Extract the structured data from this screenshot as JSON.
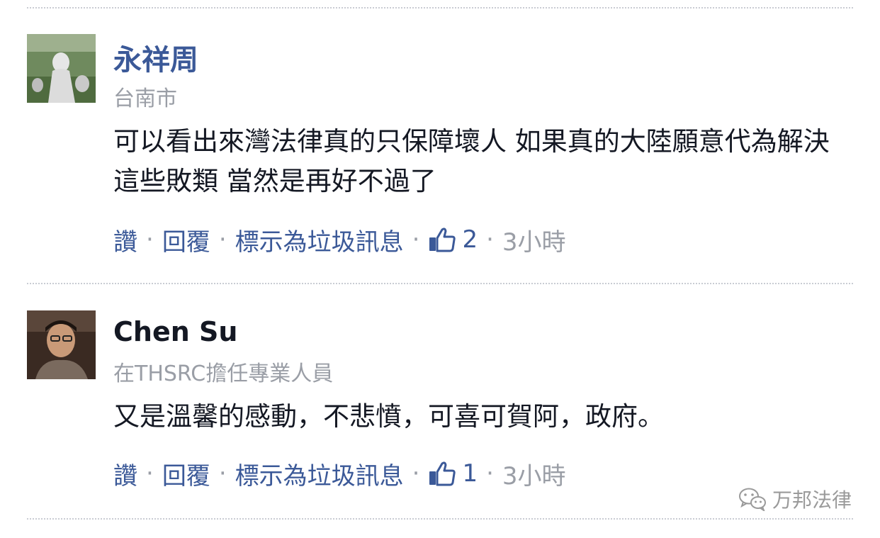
{
  "comments": [
    {
      "author": "永祥周",
      "subtitle": "台南市",
      "text": "可以看出來灣法律真的只保障壞人 如果真的大陸願意代為解決這些敗類 當然是再好不過了",
      "actions": {
        "like": "讚",
        "reply": "回覆",
        "spam": "標示為垃圾訊息"
      },
      "like_count": "2",
      "time": "3小時"
    },
    {
      "author": "Chen Su",
      "subtitle": "在THSRC擔任專業人員",
      "text": "又是溫馨的感動，不悲憤，可喜可賀阿，政府。",
      "actions": {
        "like": "讚",
        "reply": "回覆",
        "spam": "標示為垃圾訊息"
      },
      "like_count": "1",
      "time": "3小時"
    }
  ],
  "separator": "·",
  "watermark": {
    "text": "万邦法律",
    "icon": "wechat-icon"
  },
  "colors": {
    "link": "#3b5998",
    "muted": "#9a9ea6",
    "text": "#141823"
  }
}
